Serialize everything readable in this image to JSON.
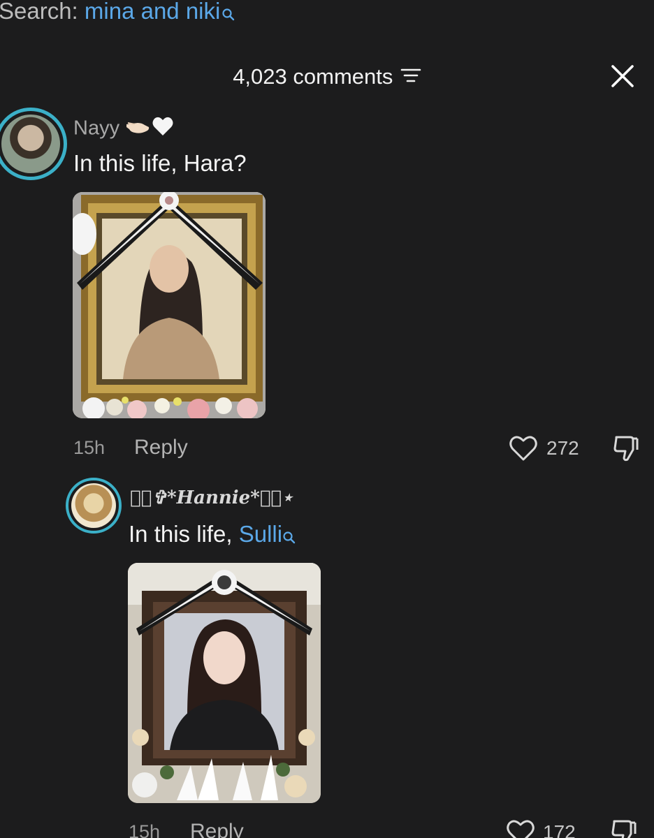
{
  "search": {
    "label": "Search:",
    "query": "mina and niki"
  },
  "header": {
    "comment_count": "4,023 comments"
  },
  "colors": {
    "background": "#1c1c1d",
    "link": "#5ba8e8",
    "avatar_ring": "#3bb0c8"
  },
  "comments": [
    {
      "author": "Nayy",
      "text": "In this life, Hara?",
      "time": "15h",
      "reply_label": "Reply",
      "likes": "272",
      "has_photo": true
    },
    {
      "author": "⋆͛✞*Hannie*✞͛⋆",
      "text_prefix": "In this life, ",
      "mention": "Sulli",
      "time": "15h",
      "reply_label": "Reply",
      "likes": "172",
      "has_photo": true
    }
  ]
}
